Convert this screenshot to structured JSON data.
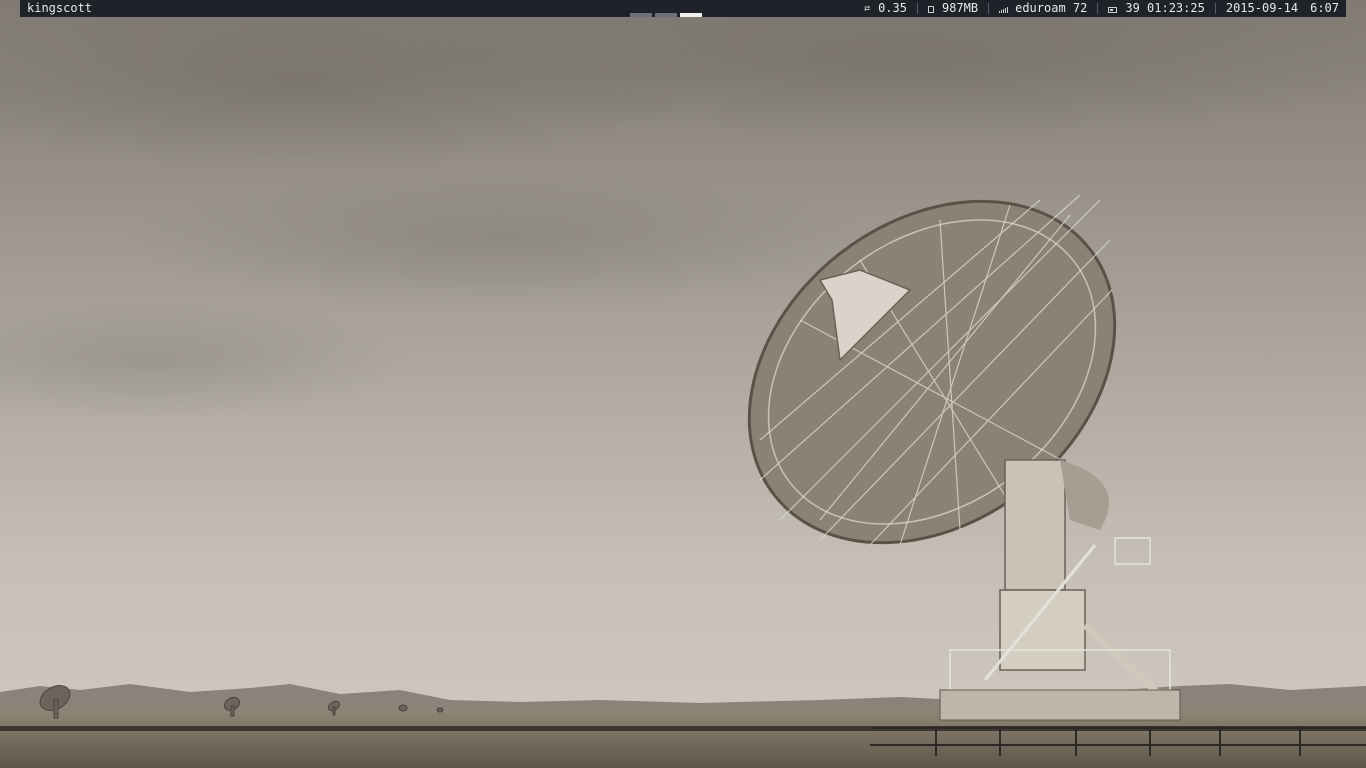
{
  "desktop": {
    "wallpaper": "radio-telescope-dish"
  },
  "topbar": {
    "hostname": "kingscott",
    "workspaces": [
      "1",
      "2",
      "3"
    ],
    "active_workspace": 3,
    "status": {
      "load": {
        "icon": "load-icon",
        "value": "0.35"
      },
      "memory": {
        "icon": "memory-icon",
        "value": "987MB"
      },
      "wifi": {
        "icon": "wifi-icon",
        "value": "eduroam 72"
      },
      "battery": {
        "icon": "battery-icon",
        "value": "39 01:23:25"
      },
      "date": "2015-09-14",
      "time": "6:07"
    }
  },
  "colors": {
    "bar_bg": "#1f2229",
    "bar_text": "#e8e8e8",
    "workspace_inactive": "#6d7079",
    "workspace_active": "#f2f2f2"
  }
}
